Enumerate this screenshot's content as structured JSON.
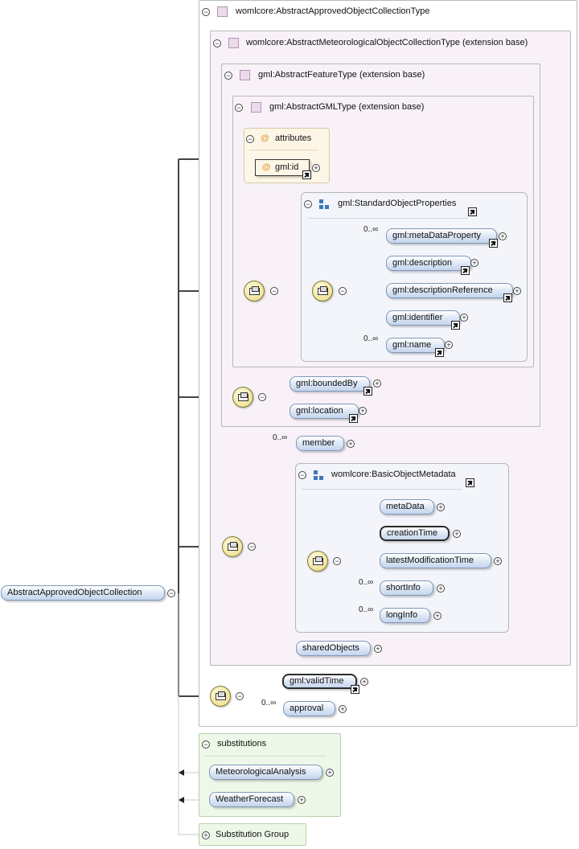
{
  "root": {
    "label": "AbstractApprovedObjectCollection"
  },
  "types": {
    "t1": "womlcore:AbstractApprovedObjectCollectionType",
    "t2": "womlcore:AbstractMeteorologicalObjectCollectionType (extension base)",
    "t3": "gml:AbstractFeatureType (extension base)",
    "t4": "gml:AbstractGMLType (extension base)"
  },
  "attributes": {
    "title": "attributes",
    "id": "gml:id"
  },
  "standard_props": {
    "title": "gml:StandardObjectProperties",
    "items": [
      "gml:metaDataProperty",
      "gml:description",
      "gml:descriptionReference",
      "gml:identifier",
      "gml:name"
    ]
  },
  "feature": {
    "items": [
      "gml:boundedBy",
      "gml:location"
    ]
  },
  "collection": {
    "member": "member",
    "shared": "sharedObjects"
  },
  "basic_meta": {
    "title": "womlcore:BasicObjectMetadata",
    "items": [
      "metaData",
      "creationTime",
      "latestModificationTime",
      "shortInfo",
      "longInfo"
    ]
  },
  "approval_seq": {
    "items": [
      "gml:validTime",
      "approval"
    ]
  },
  "cardinality": {
    "unbounded": "0..∞"
  },
  "substitutions": {
    "title": "substitutions",
    "items": [
      "MeteorologicalAnalysis",
      "WeatherForecast"
    ]
  },
  "substitution_group": {
    "label": "Substitution Group"
  },
  "colors": {
    "type_bg": "#f8f2f8",
    "attr_bg": "#fdf6e6",
    "props_bg": "#f3f5fa",
    "subst_bg": "#eef8e9",
    "element_fill": "#d6e2f3",
    "compositor": "#f3e6a6"
  }
}
